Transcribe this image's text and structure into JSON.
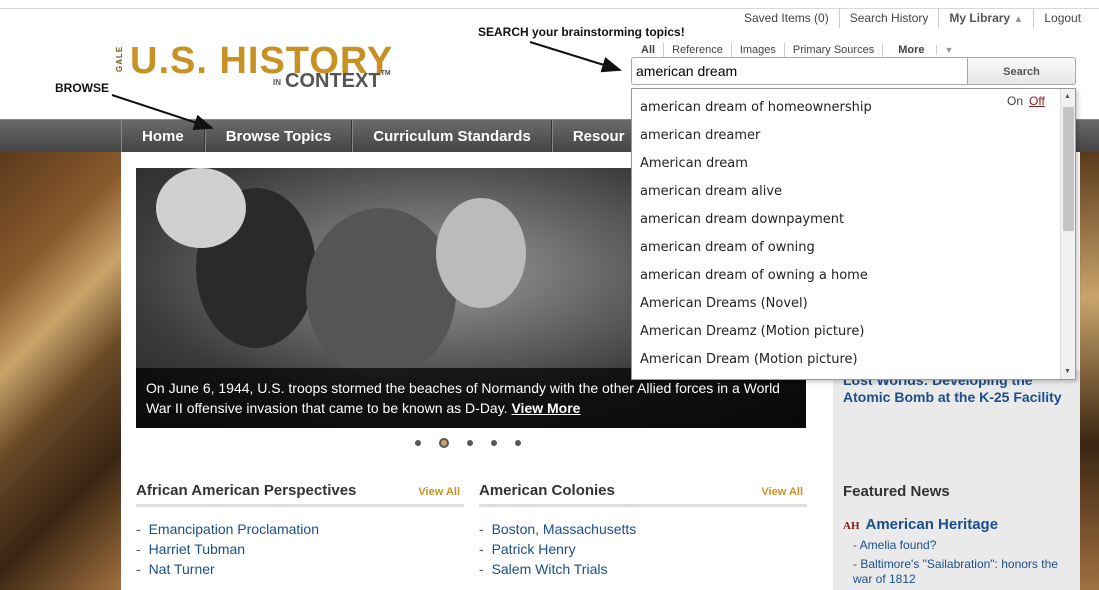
{
  "utility": {
    "saved": "Saved Items (0)",
    "history": "Search History",
    "library": "My Library",
    "logout": "Logout"
  },
  "logo": {
    "gale": "GALE",
    "title": "U.S. HISTORY",
    "in": "IN",
    "context": "CONTEXT",
    "tm": "TM"
  },
  "annotations": {
    "search": "SEARCH your brainstorming topics!",
    "browse": "BROWSE"
  },
  "search_tabs": [
    "All",
    "Reference",
    "Images",
    "Primary Sources",
    "More"
  ],
  "search": {
    "value": "american dream",
    "button": "Search"
  },
  "nav": [
    "Home",
    "Browse Topics",
    "Curriculum Standards",
    "Resour"
  ],
  "hero": {
    "caption": "On June 6, 1944, U.S. troops stormed the beaches of Normandy with the other Allied forces in a World War II offensive invasion that came to be known as D-Day.",
    "link": "View More"
  },
  "sections": [
    {
      "title": "African American Perspectives",
      "view_all": "View All",
      "items": [
        "Emancipation Proclamation",
        "Harriet Tubman",
        "Nat Turner"
      ]
    },
    {
      "title": "American Colonies",
      "view_all": "View All",
      "items": [
        "Boston, Massachusetts",
        "Patrick Henry",
        "Salem Witch Trials"
      ]
    }
  ],
  "right": {
    "link": "Lost Worlds: Developing the Atomic Bomb at the K-25 Facility",
    "featured_title": "Featured News",
    "source_badge": "AH",
    "source": "American Heritage",
    "items": [
      "Amelia found?",
      "Baltimore's \"Sailabration\": honors the war of 1812"
    ]
  },
  "dropdown": {
    "on": "On",
    "off": "Off",
    "suggestions": [
      "american dream of homeownership",
      "american dreamer",
      "American dream",
      "american dream alive",
      "american dream downpayment",
      "american dream of owning",
      "american dream of owning a home",
      "American Dreams (Novel)",
      "American Dreamz (Motion picture)",
      "American Dream (Motion picture)"
    ]
  },
  "carousel": {
    "count": 5,
    "active": 2
  }
}
